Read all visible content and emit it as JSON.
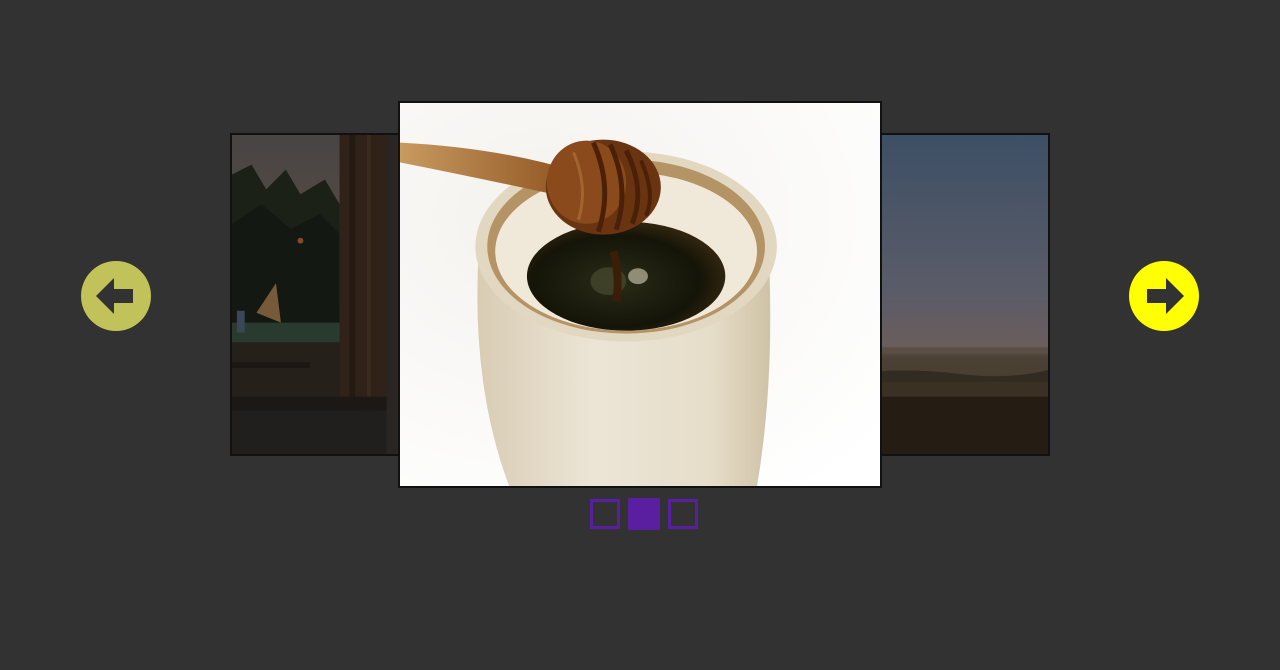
{
  "carousel": {
    "slides": [
      {
        "name": "window-forest-evening",
        "position": "previous"
      },
      {
        "name": "honey-pot-with-dipper",
        "position": "current"
      },
      {
        "name": "field-at-dusk",
        "position": "next"
      }
    ],
    "prev_icon": "arrow-left-circle-icon",
    "next_icon": "arrow-right-circle-icon",
    "prev_color": "#c2c25a",
    "next_color": "#ffff00",
    "indicator_color": "#5a1fa0",
    "indicator_count": 3,
    "active_indicator": 2
  }
}
